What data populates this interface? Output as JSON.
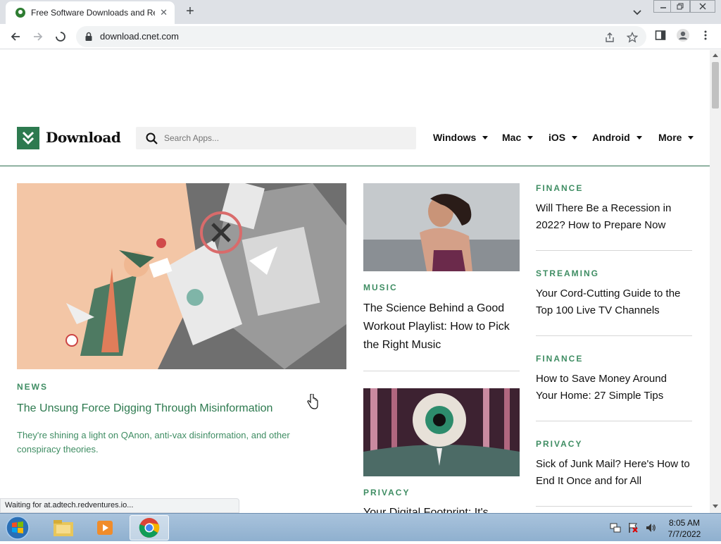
{
  "browser": {
    "tab_title": "Free Software Downloads and Re",
    "tab_close": "✕",
    "new_tab": "+",
    "url": "download.cnet.com"
  },
  "site": {
    "logo_text": "Download",
    "search_placeholder": "Search Apps...",
    "nav": [
      {
        "label": "Windows"
      },
      {
        "label": "Mac"
      },
      {
        "label": "iOS"
      },
      {
        "label": "Android"
      },
      {
        "label": "More"
      }
    ]
  },
  "hero": {
    "kicker": "NEWS",
    "headline": "The Unsung Force Digging Through Misinformation",
    "dek": "They're shining a light on QAnon, anti-vax disinformation, and other conspiracy theories."
  },
  "middle": [
    {
      "kicker": "MUSIC",
      "headline": "The Science Behind a Good Workout Playlist: How to Pick the Right Music"
    },
    {
      "kicker": "PRIVACY",
      "headline": "Your Digital Footprint: It's"
    }
  ],
  "right": [
    {
      "kicker": "FINANCE",
      "headline": "Will There Be a Recession in 2022? How to Prepare Now"
    },
    {
      "kicker": "STREAMING",
      "headline": "Your Cord-Cutting Guide to the Top 100 Live TV Channels"
    },
    {
      "kicker": "FINANCE",
      "headline": "How to Save Money Around Your Home: 27 Simple Tips"
    },
    {
      "kicker": "PRIVACY",
      "headline": "Sick of Junk Mail? Here's How to End It Once and for All"
    }
  ],
  "status_text": "Waiting for at.adtech.redventures.io...",
  "taskbar": {
    "time": "8:05 AM",
    "date": "7/7/2022"
  },
  "colors": {
    "brand_green": "#2d7a4f",
    "kicker_green": "#3f8d63"
  }
}
